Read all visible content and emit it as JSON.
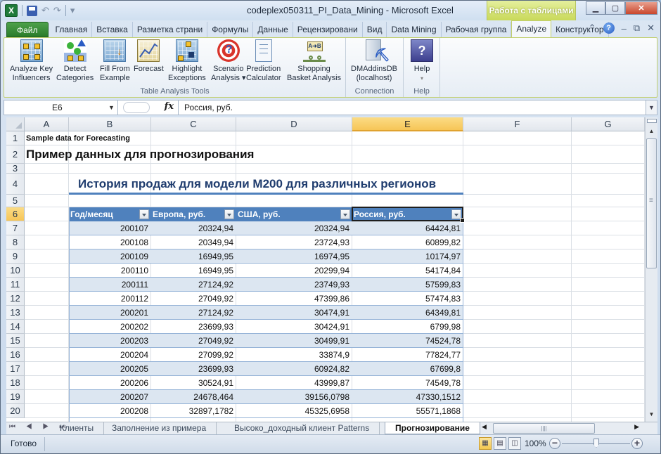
{
  "window": {
    "title": "codeplex050311_PI_Data_Mining  -  Microsoft Excel",
    "context_header": "Работа с таблицами",
    "app_icon": "X",
    "qat": {
      "save": "save-icon",
      "undo": "↶",
      "redo": "↷",
      "customize": "▾"
    },
    "controls": {
      "minimize": "▁",
      "maximize": "▢",
      "close": "✕"
    }
  },
  "ribbon_tabs": [
    {
      "label": "Файл"
    },
    {
      "label": "Главная"
    },
    {
      "label": "Вставка"
    },
    {
      "label": "Разметка страни"
    },
    {
      "label": "Формулы"
    },
    {
      "label": "Данные"
    },
    {
      "label": "Рецензировани"
    },
    {
      "label": "Вид"
    },
    {
      "label": "Data Mining"
    },
    {
      "label": "Рабочая группа"
    },
    {
      "label": "Analyze"
    },
    {
      "label": "Конструктор"
    }
  ],
  "ribbon_right": {
    "collapse": "⌃",
    "help": "?",
    "minimize": "–",
    "restore": "⧉",
    "close": "✕"
  },
  "ribbon": {
    "groups": [
      {
        "label": "Table Analysis Tools",
        "buttons": [
          {
            "line1": "Analyze Key",
            "line2": "Influencers"
          },
          {
            "line1": "Detect",
            "line2": "Categories"
          },
          {
            "line1": "Fill From",
            "line2": "Example"
          },
          {
            "line1": "Forecast",
            "line2": ""
          },
          {
            "line1": "Highlight",
            "line2": "Exceptions"
          },
          {
            "line1": "Scenario",
            "line2": "Analysis ▾"
          },
          {
            "line1": "Prediction",
            "line2": "Calculator"
          },
          {
            "line1": "Shopping",
            "line2": "Basket Analysis"
          }
        ]
      },
      {
        "label": "Connection",
        "buttons": [
          {
            "line1": "DMAddinsDB",
            "line2": "(localhost)"
          }
        ]
      },
      {
        "label": "Help",
        "buttons": [
          {
            "line1": "Help",
            "line2": "▾"
          }
        ]
      }
    ]
  },
  "formula_bar": {
    "name_box": "E6",
    "fx": "fx",
    "value": "Россия, руб."
  },
  "sheet": {
    "columns": [
      "A",
      "B",
      "C",
      "D",
      "E",
      "F",
      "G"
    ],
    "selected_column": "E",
    "rows": [
      "1",
      "2",
      "3",
      "4",
      "5",
      "6",
      "7",
      "8",
      "9",
      "10",
      "11",
      "12",
      "13",
      "14",
      "15",
      "16",
      "17",
      "18",
      "19",
      "20"
    ],
    "selected_row": "6",
    "a1": "Sample data for Forecasting",
    "a2": "Пример данных для прогнозирования",
    "b4": "История продаж для модели M200 для различных регионов",
    "table": {
      "headers": [
        "Год/месяц",
        "Европа, руб.",
        "США, руб.",
        "Россия, руб."
      ],
      "rows": [
        [
          "200107",
          "20324,94",
          "20324,94",
          "64424,81"
        ],
        [
          "200108",
          "20349,94",
          "23724,93",
          "60899,82"
        ],
        [
          "200109",
          "16949,95",
          "16974,95",
          "10174,97"
        ],
        [
          "200110",
          "16949,95",
          "20299,94",
          "54174,84"
        ],
        [
          "200111",
          "27124,92",
          "23749,93",
          "57599,83"
        ],
        [
          "200112",
          "27049,92",
          "47399,86",
          "57474,83"
        ],
        [
          "200201",
          "27124,92",
          "30474,91",
          "64349,81"
        ],
        [
          "200202",
          "23699,93",
          "30424,91",
          "6799,98"
        ],
        [
          "200203",
          "27049,92",
          "30499,91",
          "74524,78"
        ],
        [
          "200204",
          "27099,92",
          "33874,9",
          "77824,77"
        ],
        [
          "200205",
          "23699,93",
          "60924,82",
          "67699,8"
        ],
        [
          "200206",
          "30524,91",
          "43999,87",
          "74549,78"
        ],
        [
          "200207",
          "24678,464",
          "39156,0798",
          "47330,1512"
        ],
        [
          "200208",
          "32897,1782",
          "45325,6958",
          "55571,1868"
        ]
      ]
    }
  },
  "sheet_tabs": {
    "nav": "⏮ ◀ ▶ ⏭",
    "tabs": [
      {
        "label": "Клиенты",
        "active": false
      },
      {
        "label": "Заполнение из примера",
        "active": false
      },
      {
        "label": "Высоко_доходный клиент Patterns",
        "active": false
      },
      {
        "label": "Прогнозирование",
        "active": true
      }
    ]
  },
  "status_bar": {
    "status": "Готово",
    "zoom": "100%",
    "zoom_fraction": 0.5,
    "view": "normal"
  }
}
